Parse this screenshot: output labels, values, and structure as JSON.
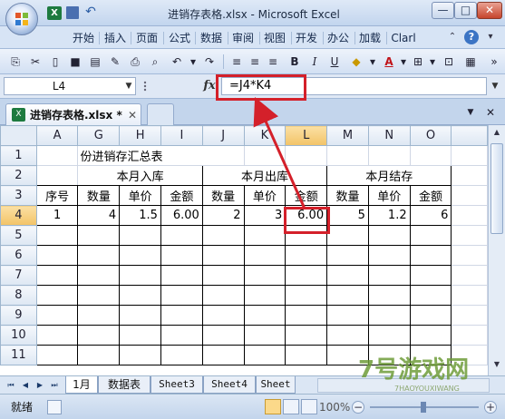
{
  "window": {
    "title": "进销存表格.xlsx - Microsoft Excel",
    "min": "—",
    "max": "□",
    "close": "✕"
  },
  "ribbon": {
    "tabs": [
      "开始",
      "插入",
      "页面",
      "公式",
      "数据",
      "审阅",
      "视图",
      "开发",
      "办公",
      "加载",
      "Clarl"
    ]
  },
  "formula_bar": {
    "name_box": "L4",
    "fx": "fx",
    "formula": "=J4*K4"
  },
  "doc_tab": {
    "label": "进销存表格.xlsx *",
    "close": "✕"
  },
  "sheet": {
    "columns": [
      "A",
      "G",
      "H",
      "I",
      "J",
      "K",
      "L",
      "M",
      "N",
      "O"
    ],
    "row_numbers": [
      "1",
      "2",
      "3",
      "4",
      "5",
      "6",
      "7",
      "8",
      "9",
      "10",
      "11"
    ],
    "title": "份进销存汇总表",
    "groups": [
      "本月入库",
      "本月出库",
      "本月结存"
    ],
    "headers": [
      "序号",
      "数量",
      "单价",
      "金额",
      "数量",
      "单价",
      "金额",
      "数量",
      "单价",
      "金额"
    ],
    "row4": [
      "1",
      "4",
      "1.5",
      "6.00",
      "2",
      "3",
      "6.00",
      "5",
      "1.2",
      "6"
    ]
  },
  "sheet_tabs": [
    "1月",
    "数据表",
    "Sheet3",
    "Sheet4",
    "Sheet"
  ],
  "status": {
    "ready": "就绪",
    "zoom": "100%"
  },
  "watermark": {
    "text": "7号游戏网",
    "sub": "7HAOYOUXIWANG"
  },
  "colors": {
    "highlight": "#d4202a",
    "selected_header": "#f2c367"
  }
}
